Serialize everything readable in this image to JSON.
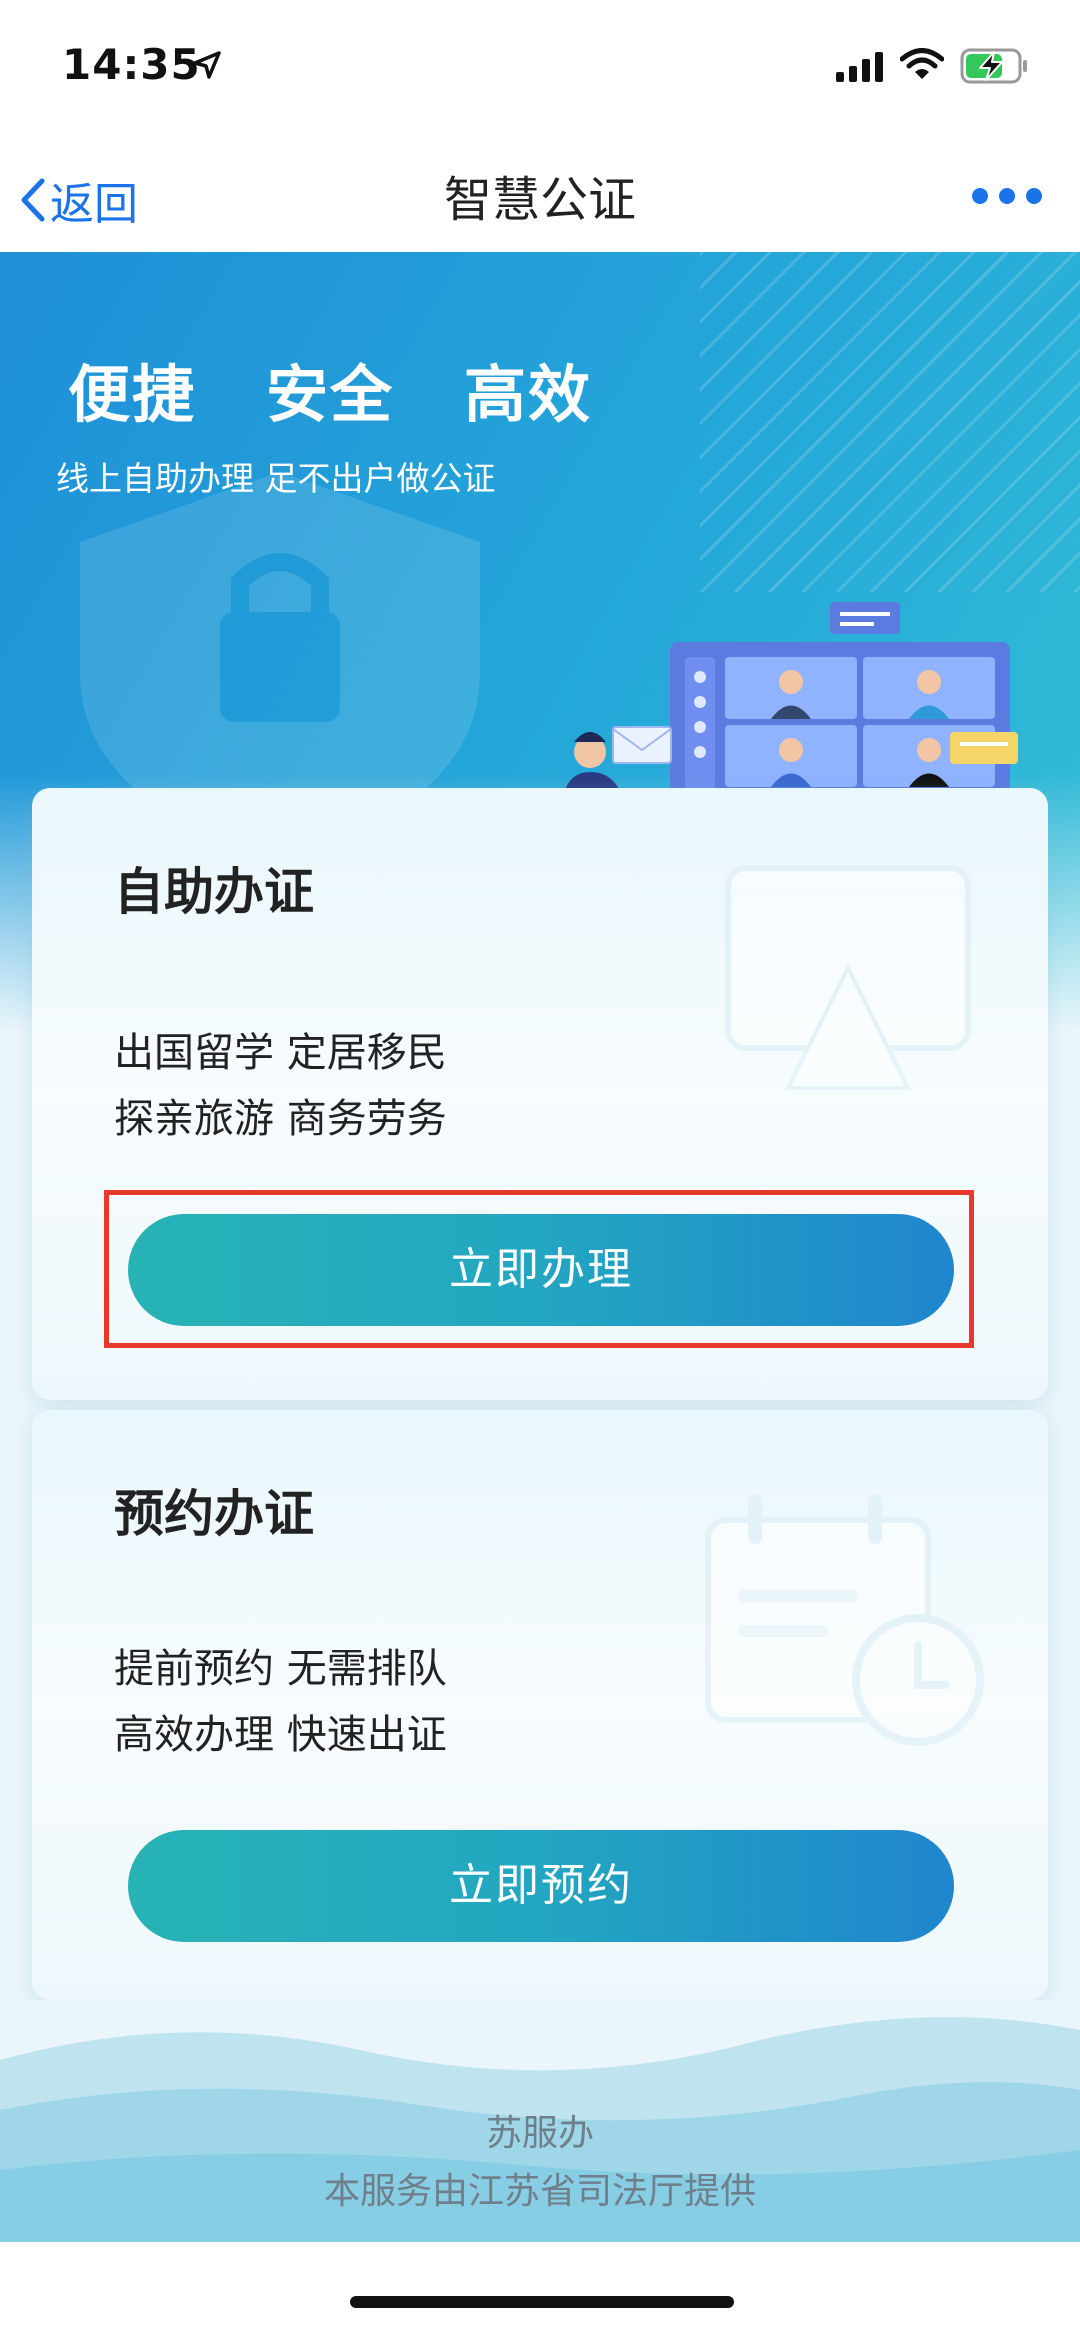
{
  "status_bar": {
    "time": "14:35"
  },
  "nav": {
    "back_label": "返回",
    "title": "智慧公证"
  },
  "hero": {
    "slogans": [
      "便捷",
      "安全",
      "高效"
    ],
    "subtitle": "线上自助办理  足不出户做公证"
  },
  "cards": [
    {
      "title": "自助办证",
      "lines": [
        "出国留学  定居移民",
        "探亲旅游  商务劳务"
      ],
      "button_label": "立即办理"
    },
    {
      "title": "预约办证",
      "lines": [
        "提前预约  无需排队",
        "高效办理  快速出证"
      ],
      "button_label": "立即预约"
    }
  ],
  "footer": {
    "brand": "苏服办",
    "note": "本服务由江苏省司法厅提供"
  },
  "colors": {
    "accent": "#1a73e8",
    "button_start": "#27b3b6",
    "button_end": "#1f86cc",
    "highlight": "#e8382b"
  }
}
